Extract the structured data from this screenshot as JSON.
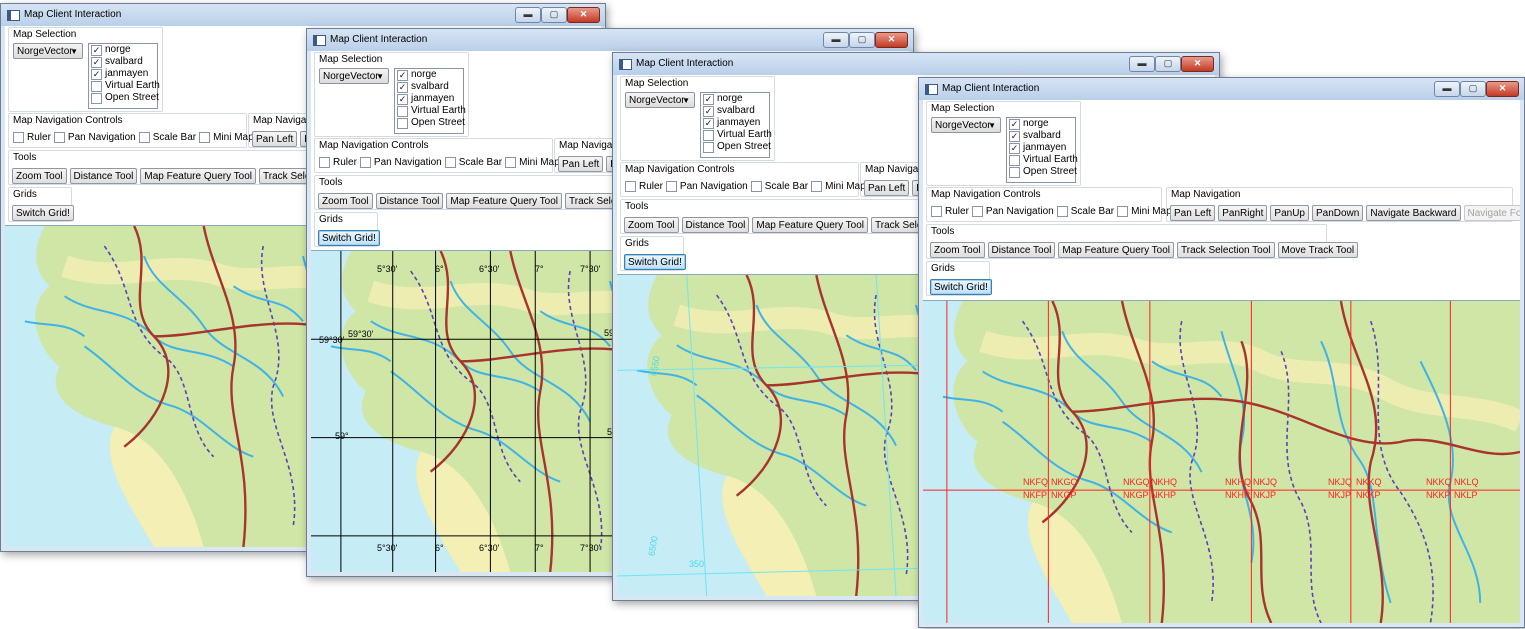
{
  "window_title": "Map Client Interaction",
  "window_controls": {
    "minimize": "▬",
    "maximize": "▢",
    "close": "✕"
  },
  "map_selection": {
    "label": "Map Selection",
    "combo_value": "NorgeVector",
    "layers": [
      {
        "label": "norge",
        "checked": true
      },
      {
        "label": "svalbard",
        "checked": true
      },
      {
        "label": "janmayen",
        "checked": true
      },
      {
        "label": "Virtual Earth",
        "checked": false
      },
      {
        "label": "Open Street",
        "checked": false
      }
    ]
  },
  "nav_controls": {
    "label": "Map Navigation Controls",
    "items": [
      "Ruler",
      "Pan Navigation",
      "Scale Bar",
      "Mini Map"
    ]
  },
  "map_navigation": {
    "label": "Map Navigation",
    "label_cut": "Map Navigati",
    "buttons": [
      "Pan Left",
      "PanRight",
      "PanUp",
      "PanDown",
      "Navigate Backward",
      "Navigate Forward"
    ],
    "cut_second": "Pa"
  },
  "tools": {
    "label": "Tools",
    "buttons": [
      "Zoom Tool",
      "Distance Tool",
      "Map Feature Query Tool",
      "Track Selection Tool",
      "Move Track Tool"
    ],
    "cut_fourth": "Track Selection"
  },
  "grids": {
    "label": "Grids",
    "button": "Switch Grid!"
  },
  "latlon_labels": {
    "top": [
      "5°30'",
      "6°",
      "6°30'",
      "7°",
      "7°30'"
    ],
    "bottom": [
      "5°30'",
      "6°",
      "6°30'",
      "7°",
      "7°30'"
    ],
    "lat_59_30": "59°30'",
    "lat_59": "59°",
    "lat_edge": "59"
  },
  "utm_labels": [
    "6550",
    "6500",
    "350"
  ],
  "mgrs_labels": {
    "upper": [
      "NKFQ",
      "NKGQ",
      "NKGQ",
      "NKHQ",
      "NKHQ",
      "NKJQ",
      "NKJQ",
      "NKKQ",
      "NKKQ",
      "NKLQ"
    ],
    "lower": [
      "NKFP",
      "NKGP",
      "NKGP",
      "NKHP",
      "NKHP",
      "NKJP",
      "NKJP",
      "NKKP",
      "NKKP",
      "NKLP"
    ]
  },
  "colors": {
    "sea": "#c6ecf6",
    "land_green": "#cfe6a6",
    "land_yellow": "#f4efb4",
    "county_border": "#a8342d",
    "municipal_border": "#5c3fb8",
    "river": "#3fb3e6",
    "grid_latlon": "#000000",
    "grid_utm": "#6fe6f0",
    "grid_mgrs": "#ff2020"
  }
}
